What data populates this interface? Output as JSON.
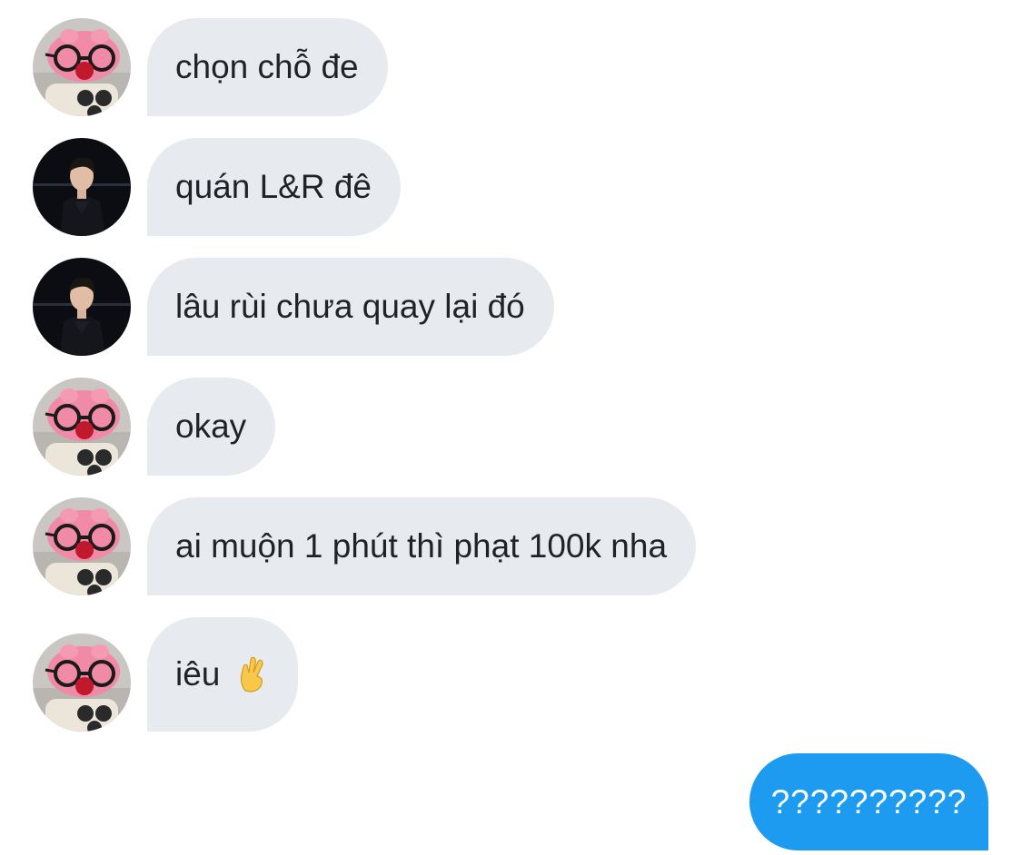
{
  "conversation": {
    "messages": [
      {
        "sender": "pig-avatar",
        "text": "chọn chỗ đe"
      },
      {
        "sender": "man-avatar",
        "text": "quán L&R đê"
      },
      {
        "sender": "man-avatar",
        "text": "lâu rùi chưa quay lại đó"
      },
      {
        "sender": "pig-avatar",
        "text": "okay"
      },
      {
        "sender": "pig-avatar",
        "text": "ai muộn 1 phút thì phạt 100k nha"
      },
      {
        "sender": "pig-avatar",
        "text": "iêu",
        "emoji": "crossed-fingers-icon"
      },
      {
        "sender": "me",
        "text": "??????????"
      }
    ]
  },
  "colors": {
    "incoming_bubble": "#e7ebef",
    "outgoing_bubble": "#1d9bf0",
    "incoming_text": "#1f2328",
    "outgoing_text": "#ffffff"
  }
}
